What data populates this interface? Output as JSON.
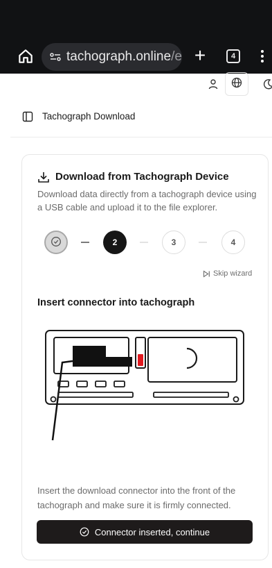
{
  "browser": {
    "url_host": "tachograph.online",
    "url_path": "/en",
    "tab_count": "4",
    "plus_label": "+"
  },
  "page": {
    "title": "Tachograph Download"
  },
  "card": {
    "title": "Download from Tachograph Device",
    "description": "Download data directly from a tachograph device using a USB cable and upload it to the file explorer."
  },
  "stepper": {
    "current_step": 2,
    "steps": [
      {
        "label": "",
        "state": "completed"
      },
      {
        "label": "2",
        "state": "current"
      },
      {
        "label": "3",
        "state": "upcoming"
      },
      {
        "label": "4",
        "state": "upcoming"
      }
    ],
    "skip_label": "Skip wizard"
  },
  "step": {
    "heading": "Insert connector into tachograph",
    "instruction": "Insert the download connector into the front of the tachograph and make sure it is firmly connected.",
    "button_label": "Connector inserted, continue"
  },
  "icons": {
    "home": "home-icon",
    "site": "site-settings-icon",
    "tabs": "tabs-icon",
    "menu": "more-vert-icon",
    "user": "user-icon",
    "globe": "globe-icon",
    "moon": "moon-icon",
    "sidebar": "sidebar-toggle-icon",
    "download": "download-icon",
    "check": "check-circle-icon",
    "skip": "skip-forward-icon"
  },
  "colors": {
    "browser_bg": "#111214",
    "url_pill": "#2a2b2f",
    "primary_button": "#1e1b1b",
    "current_step": "#161616",
    "connector_led": "#e0191f"
  }
}
